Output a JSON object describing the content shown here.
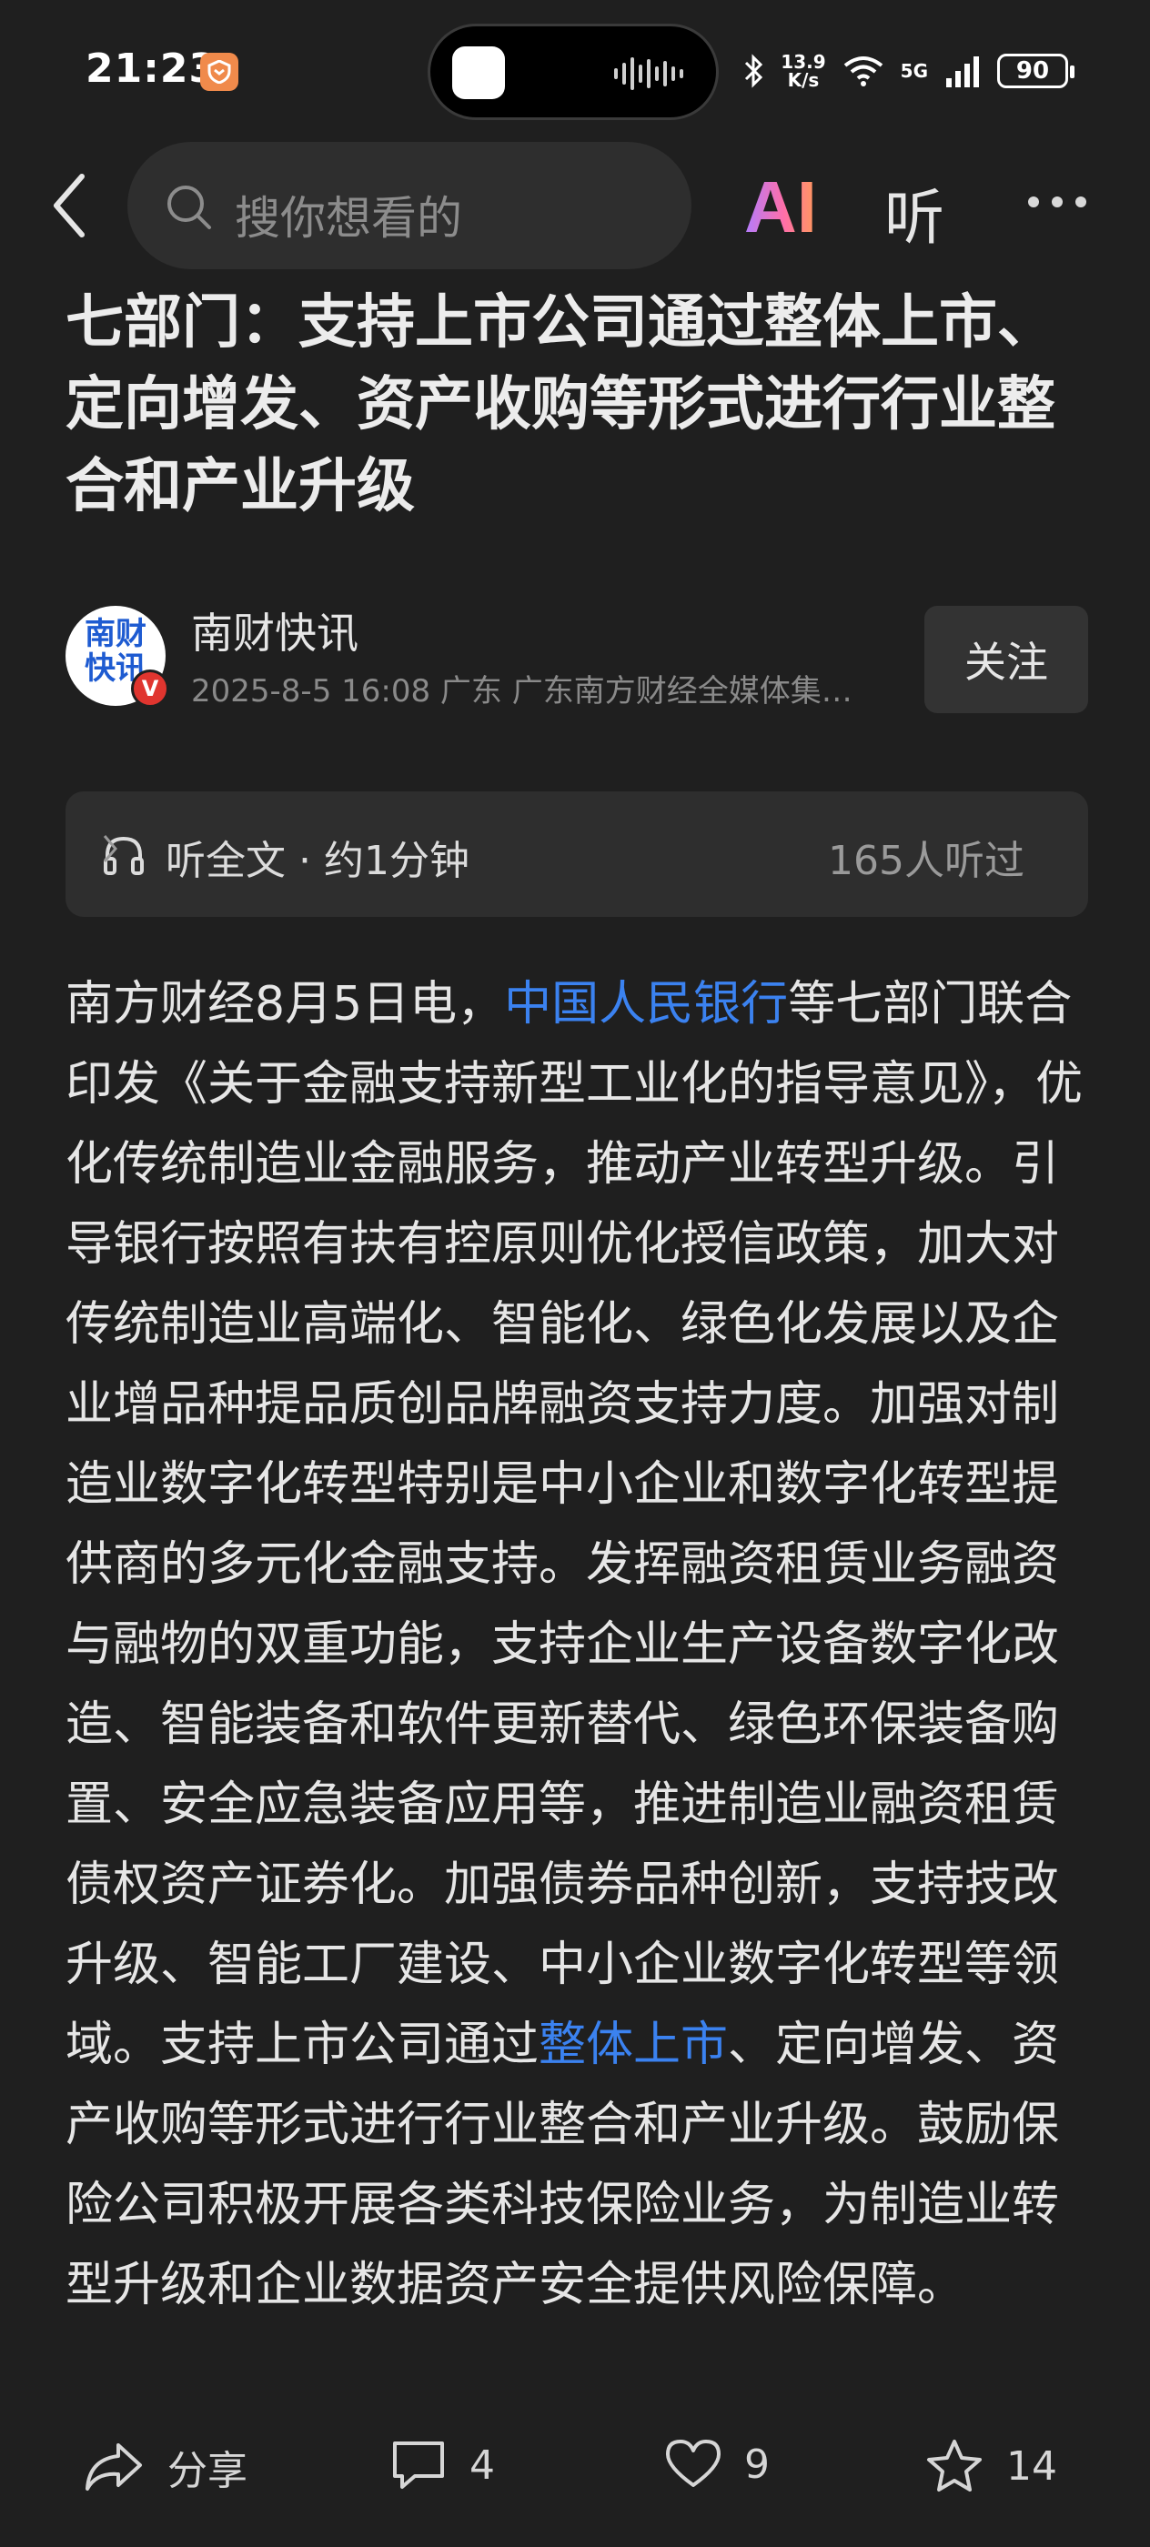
{
  "status_bar": {
    "time": "21:23",
    "net_speed_value": "13.9",
    "net_speed_unit": "K/s",
    "network": "5G",
    "battery": "90"
  },
  "nav": {
    "search_placeholder": "搜你想看的",
    "ai_label": "AI",
    "listen_label": "听"
  },
  "article": {
    "title": "七部门：支持上市公司通过整体上市、定向增发、资产收购等形式进行行业整合和产业升级",
    "author": {
      "avatar_text": "南财快讯",
      "name": "南财快讯",
      "meta": "2025-8-5  16:08  广东  广东南方财经全媒体集…",
      "follow_label": "关注"
    },
    "listen_bar": {
      "label": "听全文 · 约1分钟",
      "count": "165人听过"
    },
    "body": {
      "part1": "南方财经8月5日电，",
      "link1": "中国人民银行",
      "part2": "等七部门联合印发《关于金融支持新型工业化的指导意见》，优化传统制造业金融服务，推动产业转型升级。引导银行按照有扶有控原则优化授信政策，加大对传统制造业高端化、智能化、绿色化发展以及企业增品种提品质创品牌融资支持力度。加强对制造业数字化转型特别是中小企业和数字化转型提供商的多元化金融支持。发挥融资租赁业务融资与融物的双重功能，支持企业生产设备数字化改造、智能装备和软件更新替代、绿色环保装备购置、安全应急装备应用等，推进制造业融资租赁债权资产证券化。加强债券品种创新，支持技改升级、智能工厂建设、中小企业数字化转型等领域。支持上市公司通过",
      "link2": "整体上市",
      "part3": "、定向增发、资产收购等形式进行行业整合和产业升级。鼓励保险公司积极开展各类科技保险业务，为制造业转型升级和企业数据资产安全提供风险保障。"
    }
  },
  "bottom_bar": {
    "share_label": "分享",
    "comments": "4",
    "likes": "9",
    "favorites": "14"
  }
}
